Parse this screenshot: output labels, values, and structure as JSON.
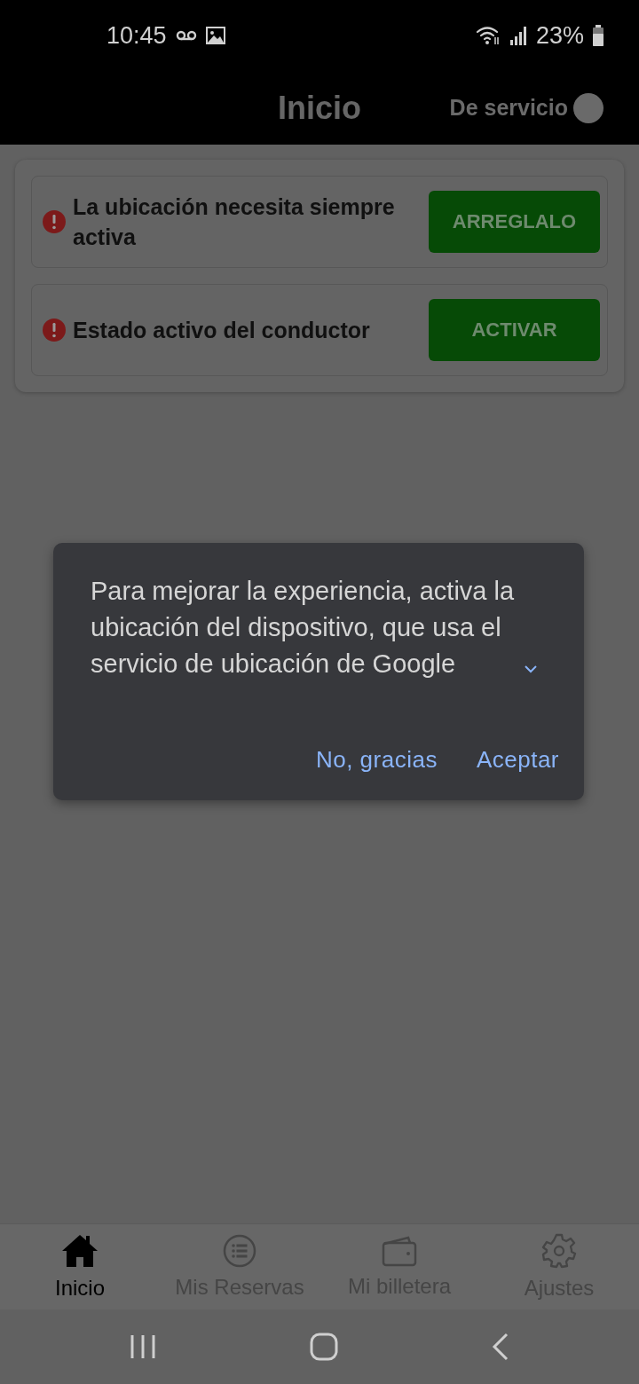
{
  "status_bar": {
    "time": "10:45",
    "battery": "23%"
  },
  "header": {
    "title": "Inicio",
    "duty_label": "De servicio",
    "on_duty": false
  },
  "alerts": [
    {
      "message": "La ubicación necesita siempre activa",
      "action": "ARREGLALO"
    },
    {
      "message": "Estado activo del conductor",
      "action": "ACTIVAR"
    }
  ],
  "dialog": {
    "message": "Para mejorar la experiencia, activa la ubicación del dispositivo, que usa el servicio de ubicación de Google",
    "buttons": [
      "No, gracias",
      "Aceptar"
    ]
  },
  "bottom_nav": [
    {
      "label": "Inicio",
      "kind": "home",
      "selected": true
    },
    {
      "label": "Mis Reservas",
      "kind": "list",
      "selected": false
    },
    {
      "label": "Mi billetera",
      "kind": "wallet",
      "selected": false
    },
    {
      "label": "Ajustes",
      "kind": "gear",
      "selected": false
    }
  ]
}
